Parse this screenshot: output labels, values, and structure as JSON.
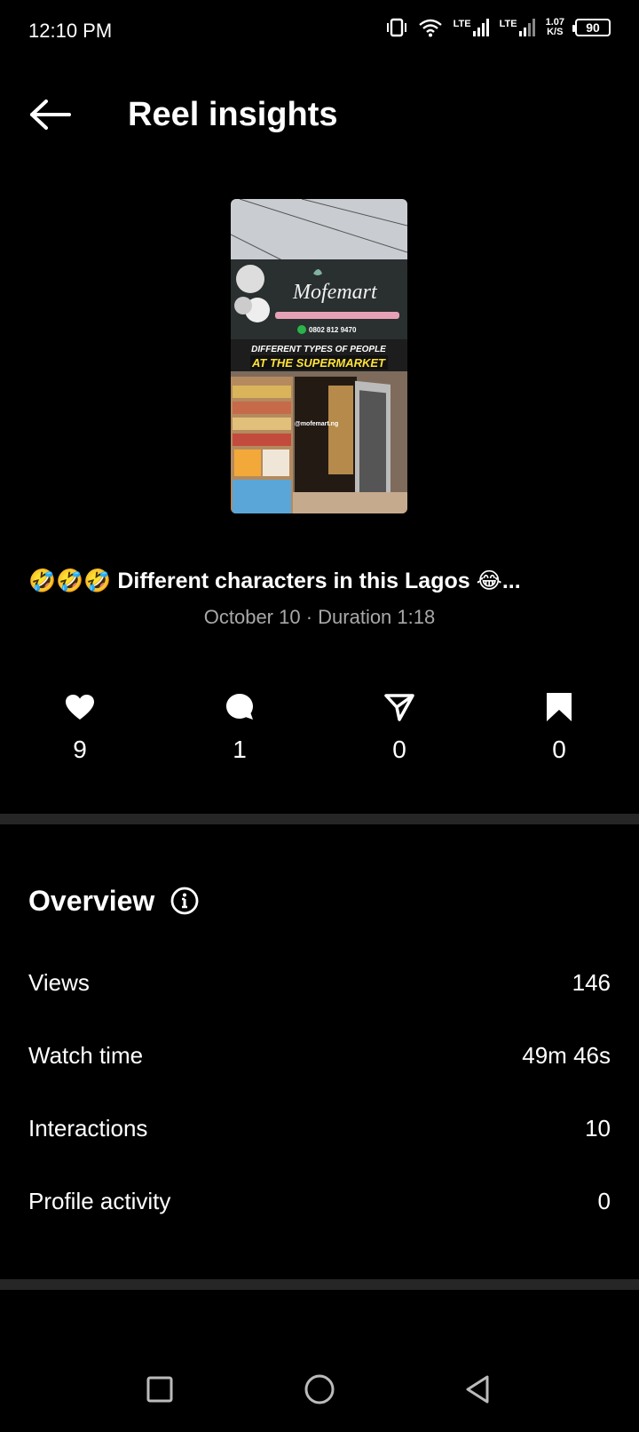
{
  "status_bar": {
    "time": "12:10 PM",
    "lte1": "LTE",
    "lte2": "LTE",
    "speed_value": "1.07",
    "speed_unit": "K/S",
    "battery": "90"
  },
  "header": {
    "title": "Reel insights",
    "back_icon": "arrow-left-icon"
  },
  "reel": {
    "thumbnail": {
      "shop_name": "Mofemart",
      "phone": "0802 812 9470",
      "overlay_line1": "DIFFERENT TYPES OF PEOPLE",
      "overlay_line2": "AT THE SUPERMARKET",
      "handle": "@mofemart.ng"
    },
    "caption": "🤣🤣🤣 Different characters in this Lagos 😂...",
    "meta": "October 10 · Duration 1:18"
  },
  "stats": [
    {
      "icon": "heart-icon",
      "value": "9"
    },
    {
      "icon": "comment-icon",
      "value": "1"
    },
    {
      "icon": "share-icon",
      "value": "0"
    },
    {
      "icon": "bookmark-icon",
      "value": "0"
    }
  ],
  "overview": {
    "title": "Overview",
    "rows": [
      {
        "label": "Views",
        "value": "146"
      },
      {
        "label": "Watch time",
        "value": "49m 46s"
      },
      {
        "label": "Interactions",
        "value": "10"
      },
      {
        "label": "Profile activity",
        "value": "0"
      }
    ]
  },
  "nav_bar": {
    "recents_icon": "square-icon",
    "home_icon": "circle-icon",
    "back_icon": "triangle-back-icon"
  }
}
